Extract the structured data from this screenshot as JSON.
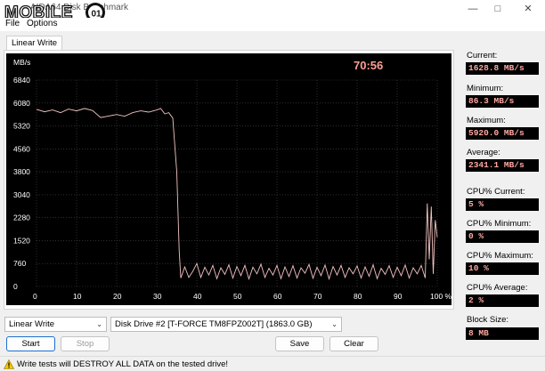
{
  "window": {
    "title": "AIDA64 Disk Benchmark",
    "logo_text": "MOBILE01"
  },
  "menu": {
    "file": "File",
    "options": "Options"
  },
  "tab": {
    "label": "Linear Write"
  },
  "timer": "70:56",
  "stats": {
    "current_label": "Current:",
    "current_value": "1628.8 MB/s",
    "minimum_label": "Minimum:",
    "minimum_value": "86.3 MB/s",
    "maximum_label": "Maximum:",
    "maximum_value": "5920.0 MB/s",
    "average_label": "Average:",
    "average_value": "2341.1 MB/s",
    "cpu_current_label": "CPU% Current:",
    "cpu_current_value": "5 %",
    "cpu_minimum_label": "CPU% Minimum:",
    "cpu_minimum_value": "0 %",
    "cpu_maximum_label": "CPU% Maximum:",
    "cpu_maximum_value": "10 %",
    "cpu_average_label": "CPU% Average:",
    "cpu_average_value": "2 %",
    "block_size_label": "Block Size:",
    "block_size_value": "8 MB"
  },
  "controls": {
    "test_select": "Linear Write",
    "drive_select": "Disk Drive #2  [T-FORCE TM8FPZ002T]  (1863.0 GB)",
    "start": "Start",
    "stop": "Stop",
    "save": "Save",
    "clear": "Clear"
  },
  "status": {
    "warning": "Write tests will DESTROY ALL DATA on the tested drive!"
  },
  "colors": {
    "plot_bg": "#000000",
    "line": "#f2c4c0",
    "value_text": "#ffa89f"
  },
  "chart_data": {
    "type": "line",
    "ylabel": "MB/s",
    "xlabel": "",
    "ylim": [
      0,
      6840
    ],
    "xlim": [
      0,
      100
    ],
    "y_ticks": [
      0,
      760,
      1520,
      2280,
      3040,
      3800,
      4560,
      5320,
      6080,
      6840
    ],
    "x_ticks": [
      "0",
      "10",
      "20",
      "30",
      "40",
      "50",
      "60",
      "70",
      "80",
      "90",
      "100 %"
    ],
    "grid": true,
    "series": [
      {
        "x": [
          0,
          2,
          4,
          6,
          8,
          10,
          12,
          14,
          16,
          18,
          20,
          22,
          24,
          26,
          28,
          30,
          31,
          32,
          33,
          34,
          35,
          35.6,
          36,
          37,
          38,
          39,
          40,
          41,
          42,
          43,
          44,
          45,
          46,
          47,
          48,
          49,
          50,
          51,
          52,
          53,
          54,
          55,
          56,
          57,
          58,
          59,
          60,
          61,
          62,
          63,
          64,
          65,
          66,
          67,
          68,
          69,
          70,
          71,
          72,
          73,
          74,
          75,
          76,
          77,
          78,
          79,
          80,
          81,
          82,
          83,
          84,
          85,
          86,
          87,
          88,
          89,
          90,
          91,
          92,
          93,
          94,
          95,
          96,
          97,
          97.5,
          98,
          98.5,
          99,
          99.5,
          100
        ],
        "y": [
          5870,
          5790,
          5850,
          5760,
          5880,
          5820,
          5900,
          5830,
          5600,
          5650,
          5700,
          5640,
          5760,
          5820,
          5780,
          5850,
          5900,
          5720,
          5760,
          5580,
          3800,
          1200,
          280,
          650,
          300,
          500,
          760,
          300,
          640,
          380,
          700,
          260,
          620,
          400,
          720,
          280,
          660,
          360,
          700,
          250,
          640,
          420,
          740,
          300,
          600,
          380,
          700,
          260,
          650,
          330,
          690,
          280,
          620,
          440,
          730,
          270,
          640,
          360,
          710,
          250,
          660,
          380,
          700,
          300,
          620,
          420,
          680,
          280,
          650,
          340,
          720,
          260,
          600,
          400,
          690,
          300,
          640,
          360,
          710,
          280,
          620,
          420,
          700,
          280,
          2750,
          900,
          2650,
          420,
          2200,
          1630
        ]
      }
    ]
  }
}
